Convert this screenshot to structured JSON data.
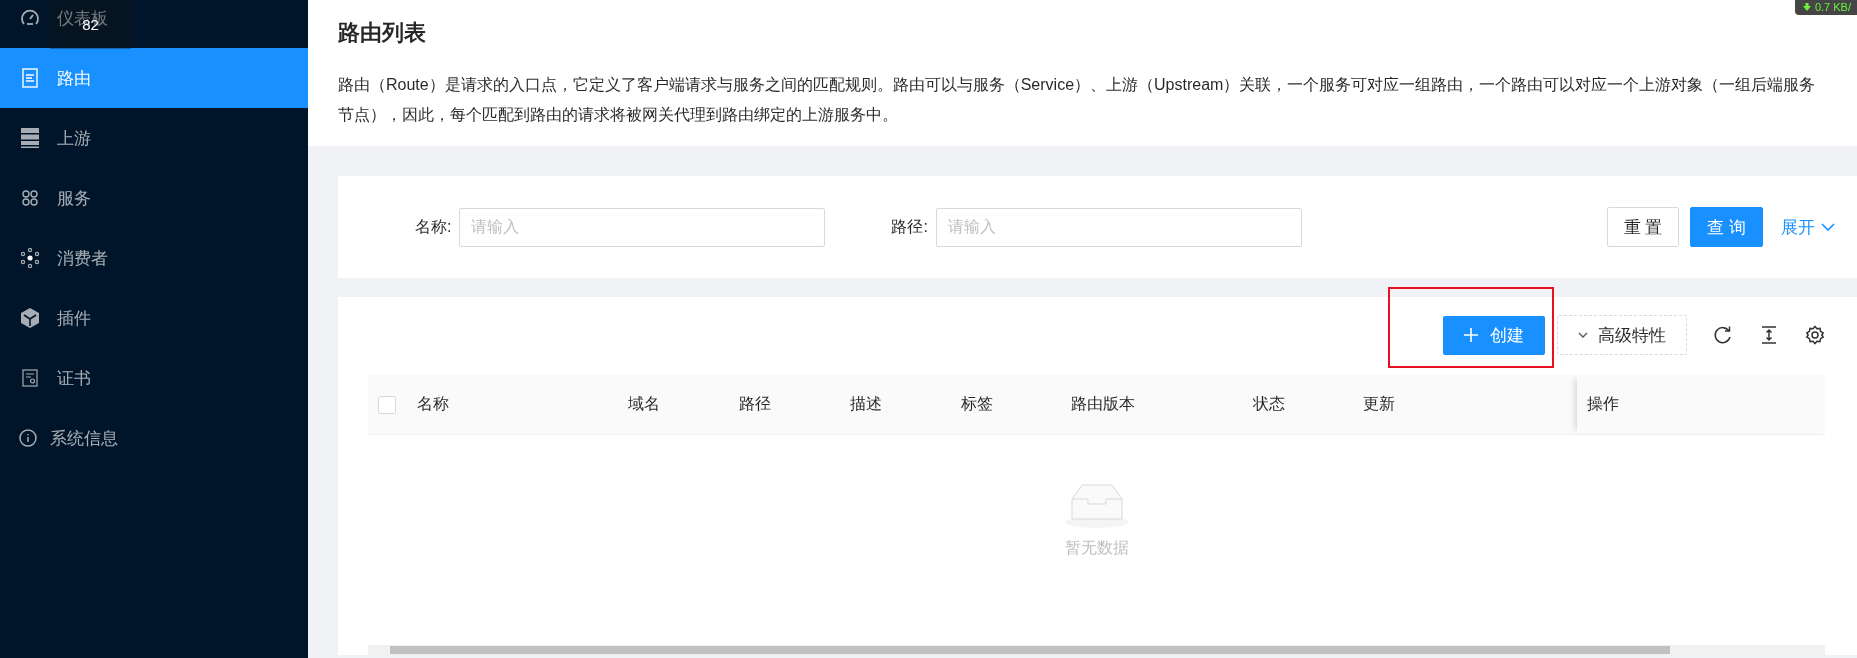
{
  "sidebar": {
    "items": [
      {
        "label": "仪表板",
        "selected": false
      },
      {
        "label": "路由",
        "selected": true
      },
      {
        "label": "上游",
        "selected": false
      },
      {
        "label": "服务",
        "selected": false
      },
      {
        "label": "消费者",
        "selected": false
      },
      {
        "label": "插件",
        "selected": false
      },
      {
        "label": "证书",
        "selected": false
      },
      {
        "label": "系统信息",
        "selected": false
      }
    ]
  },
  "overlay_badge": "82",
  "network_badge": "0.7 KB/",
  "page": {
    "title": "路由列表",
    "description": "路由（Route）是请求的入口点，它定义了客户端请求与服务之间的匹配规则。路由可以与服务（Service）、上游（Upstream）关联，一个服务可对应一组路由，一个路由可以对应一个上游对象（一组后端服务节点），因此，每个匹配到路由的请求将被网关代理到路由绑定的上游服务中。"
  },
  "search": {
    "fields": [
      {
        "label": "名称:",
        "placeholder": "请输入"
      },
      {
        "label": "路径:",
        "placeholder": "请输入"
      }
    ],
    "buttons": [
      {
        "label": "重 置",
        "kind": "default"
      },
      {
        "label": "查 询",
        "kind": "primary"
      }
    ],
    "expand": "展开"
  },
  "toolbar": {
    "create": "创建",
    "highlighted": true,
    "advanced": "高级特性"
  },
  "table": {
    "columns": [
      {
        "label": "名称"
      },
      {
        "label": "域名"
      },
      {
        "label": "路径"
      },
      {
        "label": "描述"
      },
      {
        "label": "标签"
      },
      {
        "label": "路由版本"
      },
      {
        "label": "状态"
      },
      {
        "label": "更新"
      },
      {
        "label": "操作",
        "fixed": true
      }
    ],
    "select_all": false,
    "empty_text": "暂无数据"
  }
}
